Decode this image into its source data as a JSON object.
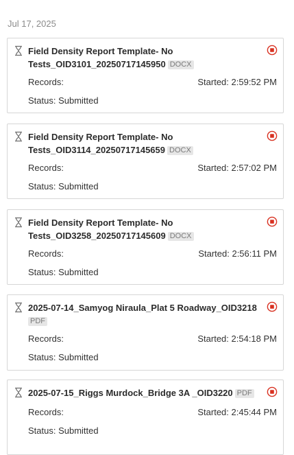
{
  "date_header": "Jul 17, 2025",
  "labels": {
    "records": "Records:",
    "status_prefix": "Status: "
  },
  "icons": {
    "pending": "hourglass-icon",
    "cancel": "cancel-stop-icon"
  },
  "colors": {
    "cancel_accent": "#d83020",
    "border": "#d6d6d6",
    "badge_bg": "#e6e6e6"
  },
  "jobs": [
    {
      "title": "Field Density Report Template- No Tests_OID3101_20250717145950",
      "format": "DOCX",
      "records": "",
      "started": "Started: 2:59:52 PM",
      "status": "Submitted"
    },
    {
      "title": "Field Density Report Template- No Tests_OID3114_20250717145659",
      "format": "DOCX",
      "records": "",
      "started": "Started: 2:57:02 PM",
      "status": "Submitted"
    },
    {
      "title": "Field Density Report Template- No Tests_OID3258_20250717145609",
      "format": "DOCX",
      "records": "",
      "started": "Started: 2:56:11 PM",
      "status": "Submitted"
    },
    {
      "title": "2025-07-14_Samyog Niraula_Plat 5 Roadway_OID3218",
      "format": "PDF",
      "records": "",
      "started": "Started: 2:54:18 PM",
      "status": "Submitted"
    },
    {
      "title": "2025-07-15_Riggs Murdock_Bridge 3A _OID3220",
      "format": "PDF",
      "records": "",
      "started": "Started: 2:45:44 PM",
      "status": "Submitted"
    }
  ]
}
